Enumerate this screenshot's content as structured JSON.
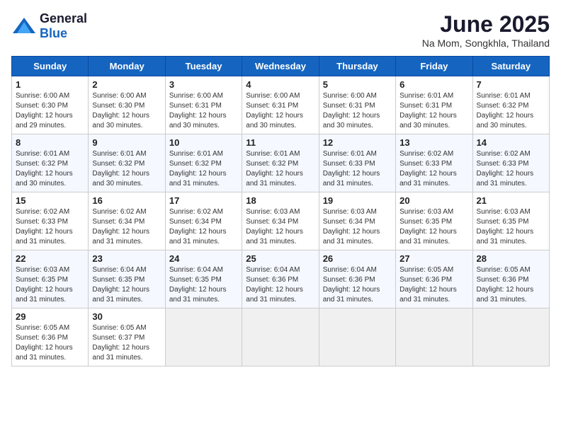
{
  "header": {
    "logo_general": "General",
    "logo_blue": "Blue",
    "title": "June 2025",
    "subtitle": "Na Mom, Songkhla, Thailand"
  },
  "calendar": {
    "days_of_week": [
      "Sunday",
      "Monday",
      "Tuesday",
      "Wednesday",
      "Thursday",
      "Friday",
      "Saturday"
    ],
    "weeks": [
      [
        null,
        null,
        null,
        null,
        null,
        null,
        null
      ]
    ],
    "cells": [
      {
        "day": null,
        "info": null
      },
      {
        "day": null,
        "info": null
      },
      {
        "day": null,
        "info": null
      },
      {
        "day": null,
        "info": null
      },
      {
        "day": null,
        "info": null
      },
      {
        "day": null,
        "info": null
      },
      {
        "day": null,
        "info": null
      }
    ]
  },
  "rows": [
    [
      {
        "day": "1",
        "sunrise": "Sunrise: 6:00 AM",
        "sunset": "Sunset: 6:30 PM",
        "daylight": "Daylight: 12 hours and 29 minutes."
      },
      {
        "day": "2",
        "sunrise": "Sunrise: 6:00 AM",
        "sunset": "Sunset: 6:30 PM",
        "daylight": "Daylight: 12 hours and 30 minutes."
      },
      {
        "day": "3",
        "sunrise": "Sunrise: 6:00 AM",
        "sunset": "Sunset: 6:31 PM",
        "daylight": "Daylight: 12 hours and 30 minutes."
      },
      {
        "day": "4",
        "sunrise": "Sunrise: 6:00 AM",
        "sunset": "Sunset: 6:31 PM",
        "daylight": "Daylight: 12 hours and 30 minutes."
      },
      {
        "day": "5",
        "sunrise": "Sunrise: 6:00 AM",
        "sunset": "Sunset: 6:31 PM",
        "daylight": "Daylight: 12 hours and 30 minutes."
      },
      {
        "day": "6",
        "sunrise": "Sunrise: 6:01 AM",
        "sunset": "Sunset: 6:31 PM",
        "daylight": "Daylight: 12 hours and 30 minutes."
      },
      {
        "day": "7",
        "sunrise": "Sunrise: 6:01 AM",
        "sunset": "Sunset: 6:32 PM",
        "daylight": "Daylight: 12 hours and 30 minutes."
      }
    ],
    [
      {
        "day": "8",
        "sunrise": "Sunrise: 6:01 AM",
        "sunset": "Sunset: 6:32 PM",
        "daylight": "Daylight: 12 hours and 30 minutes."
      },
      {
        "day": "9",
        "sunrise": "Sunrise: 6:01 AM",
        "sunset": "Sunset: 6:32 PM",
        "daylight": "Daylight: 12 hours and 30 minutes."
      },
      {
        "day": "10",
        "sunrise": "Sunrise: 6:01 AM",
        "sunset": "Sunset: 6:32 PM",
        "daylight": "Daylight: 12 hours and 31 minutes."
      },
      {
        "day": "11",
        "sunrise": "Sunrise: 6:01 AM",
        "sunset": "Sunset: 6:32 PM",
        "daylight": "Daylight: 12 hours and 31 minutes."
      },
      {
        "day": "12",
        "sunrise": "Sunrise: 6:01 AM",
        "sunset": "Sunset: 6:33 PM",
        "daylight": "Daylight: 12 hours and 31 minutes."
      },
      {
        "day": "13",
        "sunrise": "Sunrise: 6:02 AM",
        "sunset": "Sunset: 6:33 PM",
        "daylight": "Daylight: 12 hours and 31 minutes."
      },
      {
        "day": "14",
        "sunrise": "Sunrise: 6:02 AM",
        "sunset": "Sunset: 6:33 PM",
        "daylight": "Daylight: 12 hours and 31 minutes."
      }
    ],
    [
      {
        "day": "15",
        "sunrise": "Sunrise: 6:02 AM",
        "sunset": "Sunset: 6:33 PM",
        "daylight": "Daylight: 12 hours and 31 minutes."
      },
      {
        "day": "16",
        "sunrise": "Sunrise: 6:02 AM",
        "sunset": "Sunset: 6:34 PM",
        "daylight": "Daylight: 12 hours and 31 minutes."
      },
      {
        "day": "17",
        "sunrise": "Sunrise: 6:02 AM",
        "sunset": "Sunset: 6:34 PM",
        "daylight": "Daylight: 12 hours and 31 minutes."
      },
      {
        "day": "18",
        "sunrise": "Sunrise: 6:03 AM",
        "sunset": "Sunset: 6:34 PM",
        "daylight": "Daylight: 12 hours and 31 minutes."
      },
      {
        "day": "19",
        "sunrise": "Sunrise: 6:03 AM",
        "sunset": "Sunset: 6:34 PM",
        "daylight": "Daylight: 12 hours and 31 minutes."
      },
      {
        "day": "20",
        "sunrise": "Sunrise: 6:03 AM",
        "sunset": "Sunset: 6:35 PM",
        "daylight": "Daylight: 12 hours and 31 minutes."
      },
      {
        "day": "21",
        "sunrise": "Sunrise: 6:03 AM",
        "sunset": "Sunset: 6:35 PM",
        "daylight": "Daylight: 12 hours and 31 minutes."
      }
    ],
    [
      {
        "day": "22",
        "sunrise": "Sunrise: 6:03 AM",
        "sunset": "Sunset: 6:35 PM",
        "daylight": "Daylight: 12 hours and 31 minutes."
      },
      {
        "day": "23",
        "sunrise": "Sunrise: 6:04 AM",
        "sunset": "Sunset: 6:35 PM",
        "daylight": "Daylight: 12 hours and 31 minutes."
      },
      {
        "day": "24",
        "sunrise": "Sunrise: 6:04 AM",
        "sunset": "Sunset: 6:35 PM",
        "daylight": "Daylight: 12 hours and 31 minutes."
      },
      {
        "day": "25",
        "sunrise": "Sunrise: 6:04 AM",
        "sunset": "Sunset: 6:36 PM",
        "daylight": "Daylight: 12 hours and 31 minutes."
      },
      {
        "day": "26",
        "sunrise": "Sunrise: 6:04 AM",
        "sunset": "Sunset: 6:36 PM",
        "daylight": "Daylight: 12 hours and 31 minutes."
      },
      {
        "day": "27",
        "sunrise": "Sunrise: 6:05 AM",
        "sunset": "Sunset: 6:36 PM",
        "daylight": "Daylight: 12 hours and 31 minutes."
      },
      {
        "day": "28",
        "sunrise": "Sunrise: 6:05 AM",
        "sunset": "Sunset: 6:36 PM",
        "daylight": "Daylight: 12 hours and 31 minutes."
      }
    ],
    [
      {
        "day": "29",
        "sunrise": "Sunrise: 6:05 AM",
        "sunset": "Sunset: 6:36 PM",
        "daylight": "Daylight: 12 hours and 31 minutes."
      },
      {
        "day": "30",
        "sunrise": "Sunrise: 6:05 AM",
        "sunset": "Sunset: 6:37 PM",
        "daylight": "Daylight: 12 hours and 31 minutes."
      },
      null,
      null,
      null,
      null,
      null
    ]
  ],
  "days_of_week": [
    "Sunday",
    "Monday",
    "Tuesday",
    "Wednesday",
    "Thursday",
    "Friday",
    "Saturday"
  ]
}
